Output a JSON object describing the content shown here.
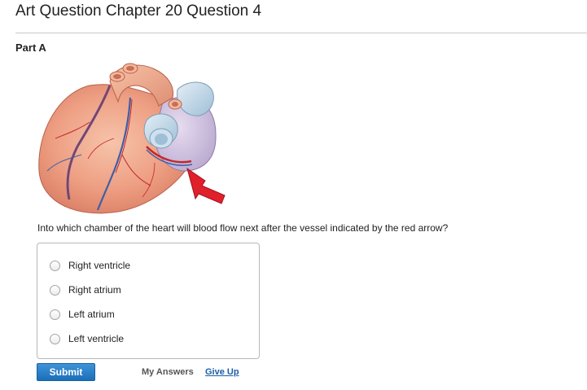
{
  "header": {
    "title": "Art Question Chapter 20 Question 4"
  },
  "part": {
    "label": "Part A"
  },
  "figure": {
    "icon": "heart-illustration",
    "arrow_color": "#e0202a"
  },
  "question": {
    "text": "Into which chamber of the heart will blood flow next after the vessel indicated by the red arrow?"
  },
  "choices": [
    {
      "label": "Right ventricle"
    },
    {
      "label": "Right atrium"
    },
    {
      "label": "Left atrium"
    },
    {
      "label": "Left ventricle"
    }
  ],
  "actions": {
    "submit_label": "Submit",
    "my_answers_label": "My Answers",
    "give_up_label": "Give Up"
  },
  "colors": {
    "submit": "#1a6fb9",
    "link": "#1a5ca8"
  }
}
